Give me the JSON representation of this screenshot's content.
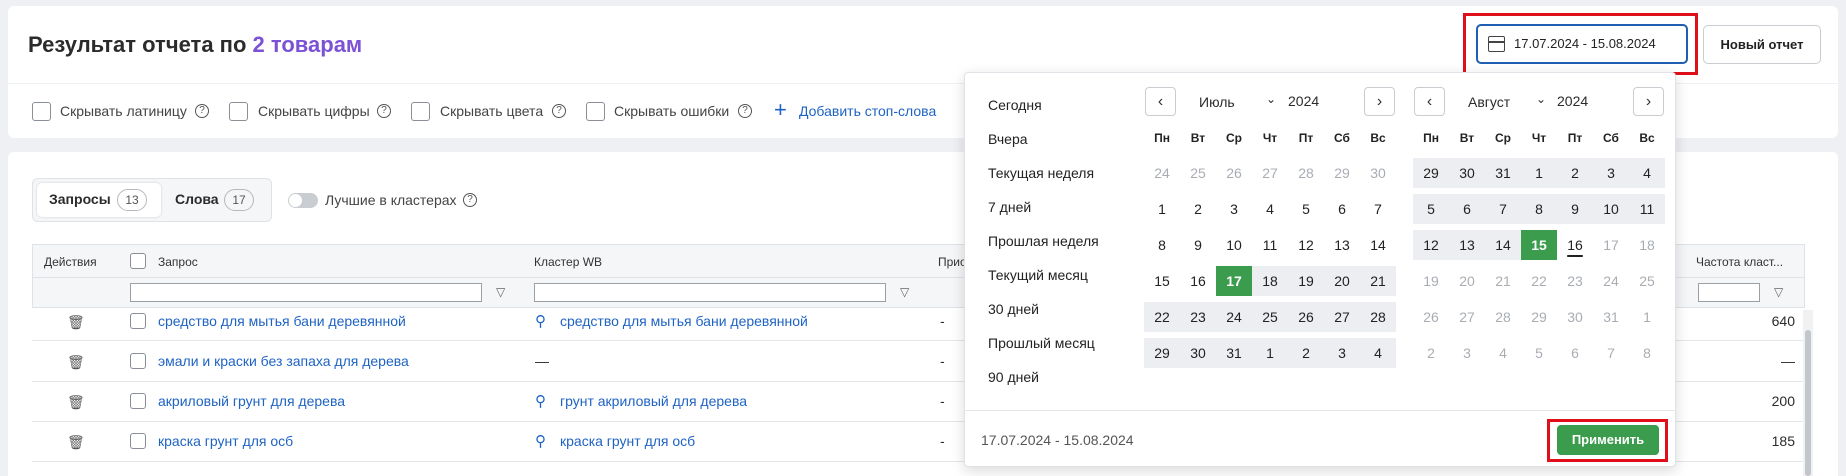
{
  "header": {
    "title_prefix": "Результат отчета по",
    "title_accent": "2 товарам",
    "date_range": "17.07.2024 - 15.08.2024",
    "new_report_label": "Новый отчет"
  },
  "filters": [
    {
      "label": "Скрывать латиницу"
    },
    {
      "label": "Скрывать цифры"
    },
    {
      "label": "Скрывать цвета"
    },
    {
      "label": "Скрывать ошибки"
    }
  ],
  "add_stopwords_label": "Добавить стоп-слова",
  "tabs": [
    {
      "label": "Запросы",
      "count": "13"
    },
    {
      "label": "Слова",
      "count": "17"
    }
  ],
  "toggle_label": "Лучшие в кластерах",
  "table": {
    "headers": {
      "actions": "Действия",
      "query": "Запрос",
      "cluster": "Кластер WB",
      "col4": "Прио",
      "freq": "Частота класт..."
    },
    "rows": [
      {
        "query": "средство для мытья бани деревянной",
        "cluster": "средство для мытья бани деревянной",
        "col4": "-",
        "freq": "640"
      },
      {
        "query": "эмали и краски без запаха для дерева",
        "cluster": "—",
        "col4": "-",
        "freq": "—"
      },
      {
        "query": "акриловый грунт для дерева",
        "cluster": "грунт акриловый для дерева",
        "col4": "-",
        "freq": "200"
      },
      {
        "query": "краска грунт для осб",
        "cluster": "краска грунт для осб",
        "col4": "-",
        "freq": "185"
      }
    ]
  },
  "datepicker": {
    "presets": [
      "Сегодня",
      "Вчера",
      "Текущая неделя",
      "7 дней",
      "Прошлая неделя",
      "Текущий месяц",
      "30 дней",
      "Прошлый месяц",
      "90 дней"
    ],
    "weekdays": [
      "Пн",
      "Вт",
      "Ср",
      "Чт",
      "Пт",
      "Сб",
      "Вс"
    ],
    "left": {
      "month": "Июль",
      "year": "2024",
      "weeks": [
        [
          "24",
          "25",
          "26",
          "27",
          "28",
          "29",
          "30"
        ],
        [
          "1",
          "2",
          "3",
          "4",
          "5",
          "6",
          "7"
        ],
        [
          "8",
          "9",
          "10",
          "11",
          "12",
          "13",
          "14"
        ],
        [
          "15",
          "16",
          "17",
          "18",
          "19",
          "20",
          "21"
        ],
        [
          "22",
          "23",
          "24",
          "25",
          "26",
          "27",
          "28"
        ],
        [
          "29",
          "30",
          "31",
          "1",
          "2",
          "3",
          "4"
        ]
      ]
    },
    "right": {
      "month": "Август",
      "year": "2024",
      "weeks": [
        [
          "29",
          "30",
          "31",
          "1",
          "2",
          "3",
          "4"
        ],
        [
          "5",
          "6",
          "7",
          "8",
          "9",
          "10",
          "11"
        ],
        [
          "12",
          "13",
          "14",
          "15",
          "16",
          "17",
          "18"
        ],
        [
          "19",
          "20",
          "21",
          "22",
          "23",
          "24",
          "25"
        ],
        [
          "26",
          "27",
          "28",
          "29",
          "30",
          "31",
          "1"
        ],
        [
          "2",
          "3",
          "4",
          "5",
          "6",
          "7",
          "8"
        ]
      ]
    },
    "footer_range": "17.07.2024 - 15.08.2024",
    "apply_label": "Применить",
    "colors": {
      "selected": "#3a9c4c",
      "in_range": "#eceef1",
      "highlight": "#e0101a",
      "accent": "#7b52d6",
      "link": "#1e63c4"
    }
  }
}
